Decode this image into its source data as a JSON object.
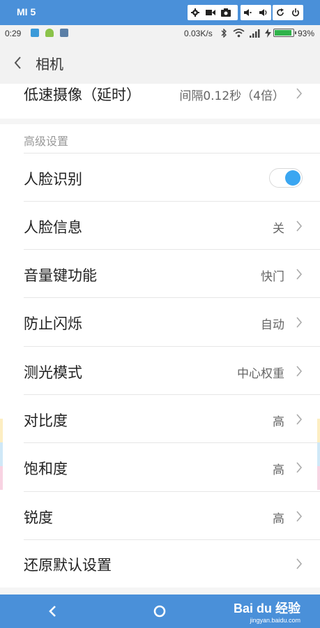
{
  "emulator": {
    "device_name": "MI 5",
    "buttons": [
      "gear-icon",
      "video-camera-icon",
      "camera-icon",
      "volume-down-icon",
      "volume-up-icon",
      "rotate-icon",
      "power-icon"
    ]
  },
  "status_bar": {
    "time": "0:29",
    "network_speed": "0.03K/s",
    "battery_percent": "93%",
    "battery_level": 0.93,
    "battery_color": "#2fb34a"
  },
  "header": {
    "title": "相机"
  },
  "top_row": {
    "label": "低速摄像（延时）",
    "value": "间隔0.12秒（4倍）"
  },
  "advanced": {
    "section_title": "高级设置",
    "face_recognition": {
      "label": "人脸识别",
      "enabled": true
    },
    "rows": [
      {
        "label": "人脸信息",
        "value": "关"
      },
      {
        "label": "音量键功能",
        "value": "快门"
      },
      {
        "label": "防止闪烁",
        "value": "自动"
      },
      {
        "label": "测光模式",
        "value": "中心权重"
      },
      {
        "label": "对比度",
        "value": "高"
      },
      {
        "label": "饱和度",
        "value": "高"
      },
      {
        "label": "锐度",
        "value": "高"
      },
      {
        "label": "还原默认设置",
        "value": ""
      }
    ]
  },
  "watermark": {
    "brand": "Bai du 经验",
    "url": "jingyan.baidu.com"
  },
  "colors": {
    "accent": "#3aa6f1",
    "emulator_blue": "#4a90d9"
  }
}
